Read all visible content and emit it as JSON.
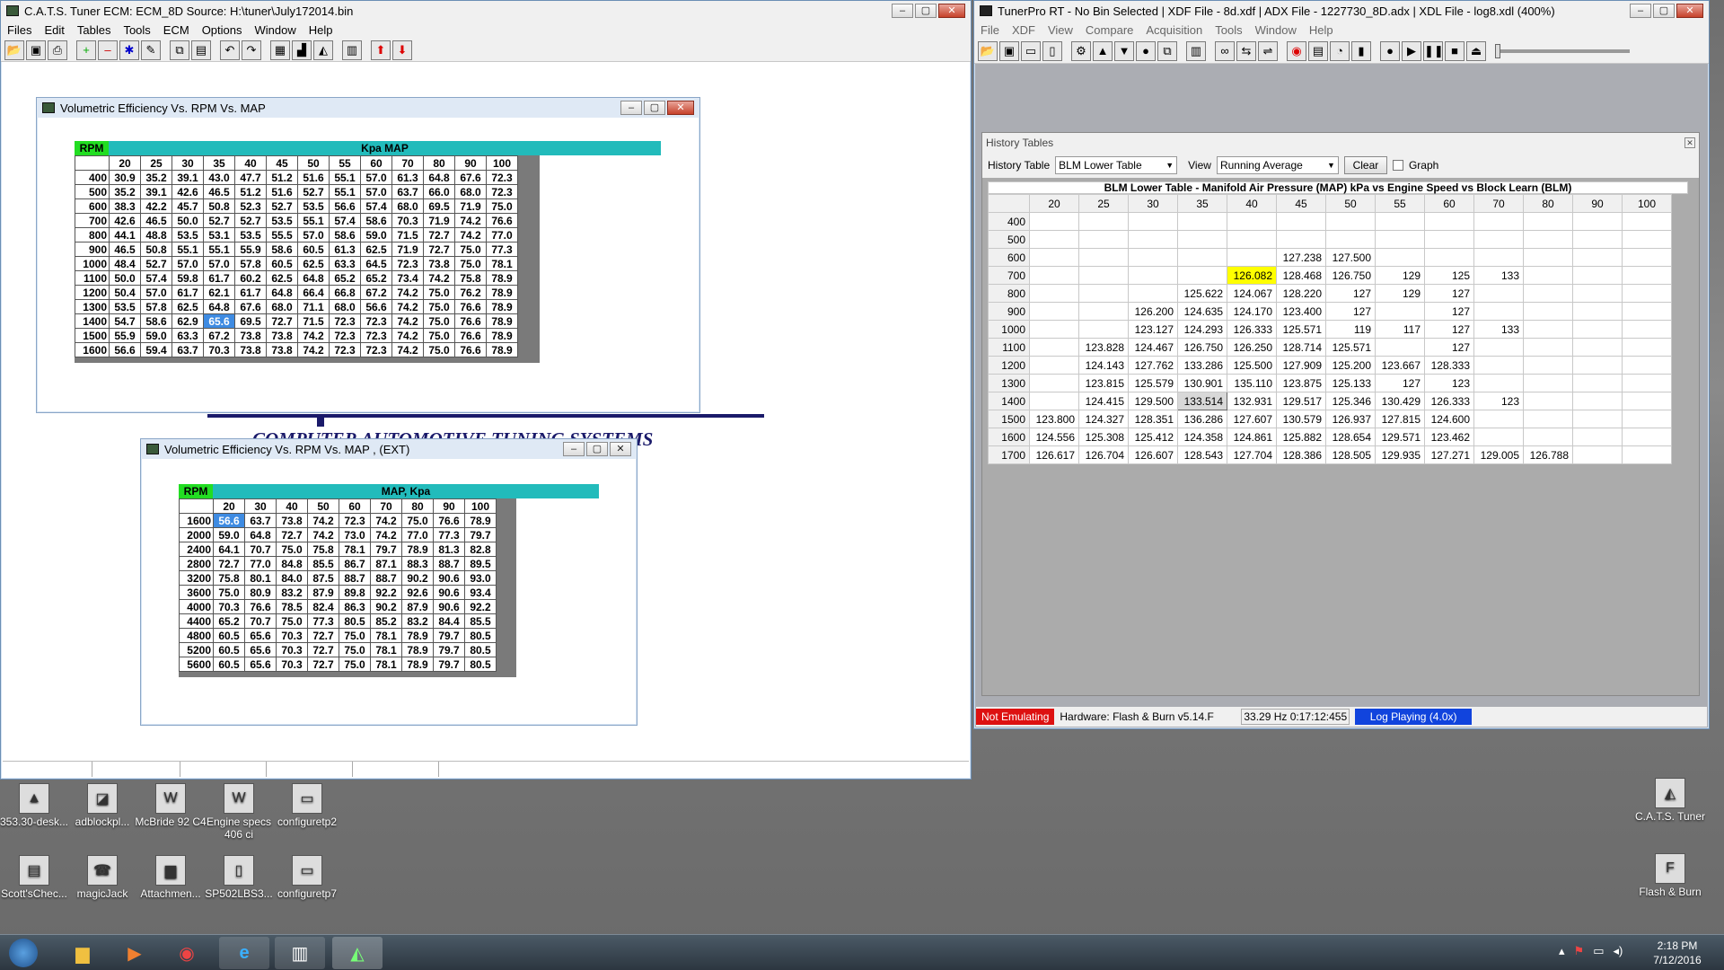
{
  "cats": {
    "title": "C.A.T.S. Tuner     ECM: ECM_8D     Source: H:\\tuner\\July172014.bin",
    "menu": [
      "Files",
      "Edit",
      "Tables",
      "Tools",
      "ECM",
      "Options",
      "Window",
      "Help"
    ],
    "banner_text": "COMPUTER AUTOMOTIVE TUNING SYSTEMS",
    "ve1": {
      "title": "Volumetric Efficiency Vs. RPM Vs. MAP",
      "corner": "RPM",
      "header": "Kpa MAP",
      "cols": [
        "20",
        "25",
        "30",
        "35",
        "40",
        "45",
        "50",
        "55",
        "60",
        "70",
        "80",
        "90",
        "100"
      ],
      "rows": [
        {
          "rpm": "400",
          "v": [
            "30.9",
            "35.2",
            "39.1",
            "43.0",
            "47.7",
            "51.2",
            "51.6",
            "55.1",
            "57.0",
            "61.3",
            "64.8",
            "67.6",
            "72.3"
          ]
        },
        {
          "rpm": "500",
          "v": [
            "35.2",
            "39.1",
            "42.6",
            "46.5",
            "51.2",
            "51.6",
            "52.7",
            "55.1",
            "57.0",
            "63.7",
            "66.0",
            "68.0",
            "72.3"
          ]
        },
        {
          "rpm": "600",
          "v": [
            "38.3",
            "42.2",
            "45.7",
            "50.8",
            "52.3",
            "52.7",
            "53.5",
            "56.6",
            "57.4",
            "68.0",
            "69.5",
            "71.9",
            "75.0"
          ]
        },
        {
          "rpm": "700",
          "v": [
            "42.6",
            "46.5",
            "50.0",
            "52.7",
            "52.7",
            "53.5",
            "55.1",
            "57.4",
            "58.6",
            "70.3",
            "71.9",
            "74.2",
            "76.6"
          ]
        },
        {
          "rpm": "800",
          "v": [
            "44.1",
            "48.8",
            "53.5",
            "53.1",
            "53.5",
            "55.5",
            "57.0",
            "58.6",
            "59.0",
            "71.5",
            "72.7",
            "74.2",
            "77.0"
          ]
        },
        {
          "rpm": "900",
          "v": [
            "46.5",
            "50.8",
            "55.1",
            "55.1",
            "55.9",
            "58.6",
            "60.5",
            "61.3",
            "62.5",
            "71.9",
            "72.7",
            "75.0",
            "77.3"
          ]
        },
        {
          "rpm": "1000",
          "v": [
            "48.4",
            "52.7",
            "57.0",
            "57.0",
            "57.8",
            "60.5",
            "62.5",
            "63.3",
            "64.5",
            "72.3",
            "73.8",
            "75.0",
            "78.1"
          ]
        },
        {
          "rpm": "1100",
          "v": [
            "50.0",
            "57.4",
            "59.8",
            "61.7",
            "60.2",
            "62.5",
            "64.8",
            "65.2",
            "65.2",
            "73.4",
            "74.2",
            "75.8",
            "78.9"
          ]
        },
        {
          "rpm": "1200",
          "v": [
            "50.4",
            "57.0",
            "61.7",
            "62.1",
            "61.7",
            "64.8",
            "66.4",
            "66.8",
            "67.2",
            "74.2",
            "75.0",
            "76.2",
            "78.9"
          ]
        },
        {
          "rpm": "1300",
          "v": [
            "53.5",
            "57.8",
            "62.5",
            "64.8",
            "67.6",
            "68.0",
            "71.1",
            "68.0",
            "56.6",
            "74.2",
            "75.0",
            "76.6",
            "78.9"
          ]
        },
        {
          "rpm": "1400",
          "v": [
            "54.7",
            "58.6",
            "62.9",
            "65.6",
            "69.5",
            "72.7",
            "71.5",
            "72.3",
            "72.3",
            "74.2",
            "75.0",
            "76.6",
            "78.9"
          ]
        },
        {
          "rpm": "1500",
          "v": [
            "55.9",
            "59.0",
            "63.3",
            "67.2",
            "73.8",
            "73.8",
            "74.2",
            "72.3",
            "72.3",
            "74.2",
            "75.0",
            "76.6",
            "78.9"
          ]
        },
        {
          "rpm": "1600",
          "v": [
            "56.6",
            "59.4",
            "63.7",
            "70.3",
            "73.8",
            "73.8",
            "74.2",
            "72.3",
            "72.3",
            "74.2",
            "75.0",
            "76.6",
            "78.9"
          ]
        }
      ]
    },
    "ve2": {
      "title": "Volumetric Efficiency Vs. RPM Vs. MAP , (EXT)",
      "corner": "RPM",
      "header": "MAP, Kpa",
      "cols": [
        "20",
        "30",
        "40",
        "50",
        "60",
        "70",
        "80",
        "90",
        "100"
      ],
      "rows": [
        {
          "rpm": "1600",
          "v": [
            "56.6",
            "63.7",
            "73.8",
            "74.2",
            "72.3",
            "74.2",
            "75.0",
            "76.6",
            "78.9"
          ]
        },
        {
          "rpm": "2000",
          "v": [
            "59.0",
            "64.8",
            "72.7",
            "74.2",
            "73.0",
            "74.2",
            "77.0",
            "77.3",
            "79.7"
          ]
        },
        {
          "rpm": "2400",
          "v": [
            "64.1",
            "70.7",
            "75.0",
            "75.8",
            "78.1",
            "79.7",
            "78.9",
            "81.3",
            "82.8"
          ]
        },
        {
          "rpm": "2800",
          "v": [
            "72.7",
            "77.0",
            "84.8",
            "85.5",
            "86.7",
            "87.1",
            "88.3",
            "88.7",
            "89.5"
          ]
        },
        {
          "rpm": "3200",
          "v": [
            "75.8",
            "80.1",
            "84.0",
            "87.5",
            "88.7",
            "88.7",
            "90.2",
            "90.6",
            "93.0"
          ]
        },
        {
          "rpm": "3600",
          "v": [
            "75.0",
            "80.9",
            "83.2",
            "87.9",
            "89.8",
            "92.2",
            "92.6",
            "90.6",
            "93.4"
          ]
        },
        {
          "rpm": "4000",
          "v": [
            "70.3",
            "76.6",
            "78.5",
            "82.4",
            "86.3",
            "90.2",
            "87.9",
            "90.6",
            "92.2"
          ]
        },
        {
          "rpm": "4400",
          "v": [
            "65.2",
            "70.7",
            "75.0",
            "77.3",
            "80.5",
            "85.2",
            "83.2",
            "84.4",
            "85.5"
          ]
        },
        {
          "rpm": "4800",
          "v": [
            "60.5",
            "65.6",
            "70.3",
            "72.7",
            "75.0",
            "78.1",
            "78.9",
            "79.7",
            "80.5"
          ]
        },
        {
          "rpm": "5200",
          "v": [
            "60.5",
            "65.6",
            "70.3",
            "72.7",
            "75.0",
            "78.1",
            "78.9",
            "79.7",
            "80.5"
          ]
        },
        {
          "rpm": "5600",
          "v": [
            "60.5",
            "65.6",
            "70.3",
            "72.7",
            "75.0",
            "78.1",
            "78.9",
            "79.7",
            "80.5"
          ]
        }
      ]
    }
  },
  "tunerpro": {
    "title": "TunerPro RT - No Bin Selected | XDF File - 8d.xdf | ADX File - 1227730_8D.adx | XDL File - log8.xdl (400%)",
    "menu": [
      "File",
      "XDF",
      "View",
      "Compare",
      "Acquisition",
      "Tools",
      "Window",
      "Help"
    ],
    "history": {
      "title": "History Tables",
      "table_label": "History Table",
      "table_value": "BLM Lower Table",
      "view_label": "View",
      "view_value": "Running Average",
      "clear_label": "Clear",
      "graph_label": "Graph",
      "caption": "BLM Lower Table - Manifold Air Pressure (MAP) kPa vs Engine Speed vs Block Learn (BLM)",
      "cols": [
        "20",
        "25",
        "30",
        "35",
        "40",
        "45",
        "50",
        "55",
        "60",
        "70",
        "80",
        "90",
        "100"
      ],
      "rows": [
        {
          "rpm": "400",
          "v": [
            "",
            "",
            "",
            "",
            "",
            "",
            "",
            "",
            "",
            "",
            "",
            "",
            ""
          ]
        },
        {
          "rpm": "500",
          "v": [
            "",
            "",
            "",
            "",
            "",
            "",
            "",
            "",
            "",
            "",
            "",
            "",
            ""
          ]
        },
        {
          "rpm": "600",
          "v": [
            "",
            "",
            "",
            "",
            "",
            "127.238",
            "127.500",
            "",
            "",
            "",
            "",
            "",
            ""
          ]
        },
        {
          "rpm": "700",
          "v": [
            "",
            "",
            "",
            "",
            "126.082",
            "128.468",
            "126.750",
            "129",
            "125",
            "133",
            "",
            "",
            ""
          ]
        },
        {
          "rpm": "800",
          "v": [
            "",
            "",
            "",
            "125.622",
            "124.067",
            "128.220",
            "127",
            "129",
            "127",
            "",
            "",
            "",
            ""
          ]
        },
        {
          "rpm": "900",
          "v": [
            "",
            "",
            "126.200",
            "124.635",
            "124.170",
            "123.400",
            "127",
            "",
            "127",
            "",
            "",
            "",
            ""
          ]
        },
        {
          "rpm": "1000",
          "v": [
            "",
            "",
            "123.127",
            "124.293",
            "126.333",
            "125.571",
            "119",
            "117",
            "127",
            "133",
            "",
            "",
            ""
          ]
        },
        {
          "rpm": "1100",
          "v": [
            "",
            "123.828",
            "124.467",
            "126.750",
            "126.250",
            "128.714",
            "125.571",
            "",
            "127",
            "",
            "",
            "",
            ""
          ]
        },
        {
          "rpm": "1200",
          "v": [
            "",
            "124.143",
            "127.762",
            "133.286",
            "125.500",
            "127.909",
            "125.200",
            "123.667",
            "128.333",
            "",
            "",
            "",
            ""
          ]
        },
        {
          "rpm": "1300",
          "v": [
            "",
            "123.815",
            "125.579",
            "130.901",
            "135.110",
            "123.875",
            "125.133",
            "127",
            "123",
            "",
            "",
            "",
            ""
          ]
        },
        {
          "rpm": "1400",
          "v": [
            "",
            "124.415",
            "129.500",
            "133.514",
            "132.931",
            "129.517",
            "125.346",
            "130.429",
            "126.333",
            "123",
            "",
            "",
            ""
          ]
        },
        {
          "rpm": "1500",
          "v": [
            "123.800",
            "124.327",
            "128.351",
            "136.286",
            "127.607",
            "130.579",
            "126.937",
            "127.815",
            "124.600",
            "",
            "",
            "",
            ""
          ]
        },
        {
          "rpm": "1600",
          "v": [
            "124.556",
            "125.308",
            "125.412",
            "124.358",
            "124.861",
            "125.882",
            "128.654",
            "129.571",
            "123.462",
            "",
            "",
            "",
            ""
          ]
        },
        {
          "rpm": "1700",
          "v": [
            "126.617",
            "126.704",
            "126.607",
            "128.543",
            "127.704",
            "128.386",
            "128.505",
            "129.935",
            "127.271",
            "129.005",
            "126.788",
            "",
            ""
          ]
        }
      ]
    },
    "status": {
      "emulating": "Not Emulating",
      "hardware": "Hardware: Flash & Burn v5.14.F",
      "rate": "33.29 Hz  0:17:12:455",
      "log": "Log Playing (4.0x)"
    }
  },
  "desktop_icons": [
    {
      "label": "353.30-desk...",
      "icon": "nvidia-icon"
    },
    {
      "label": "adblockpl...",
      "icon": "adblock-icon"
    },
    {
      "label": "McBride 92 C4",
      "icon": "word-doc-icon"
    },
    {
      "label": "Engine specs 406 ci",
      "icon": "word-doc-icon"
    },
    {
      "label": "configuretp2",
      "icon": "config-icon"
    },
    {
      "label": "Scott'sChec...",
      "icon": "checkbook-icon"
    },
    {
      "label": "magicJack",
      "icon": "magicjack-icon"
    },
    {
      "label": "Attachmen...",
      "icon": "folder-icon"
    },
    {
      "label": "SP502LBS3...",
      "icon": "file-icon"
    },
    {
      "label": "configuretp7",
      "icon": "config-icon"
    },
    {
      "label": "C.A.T.S. Tuner",
      "icon": "cats-icon"
    },
    {
      "label": "Flash & Burn",
      "icon": "flash-burn-icon"
    }
  ],
  "taskbar": {
    "time": "2:18 PM",
    "date": "7/12/2016"
  },
  "colors": {
    "rpm_label_bg": "#22dd22",
    "header_bg": "#22bbbb",
    "selected_cell": "#3e8be2",
    "highlight_cell": "#ffff00",
    "not_emulating": "#dd1111",
    "log_playing": "#1144dd"
  }
}
